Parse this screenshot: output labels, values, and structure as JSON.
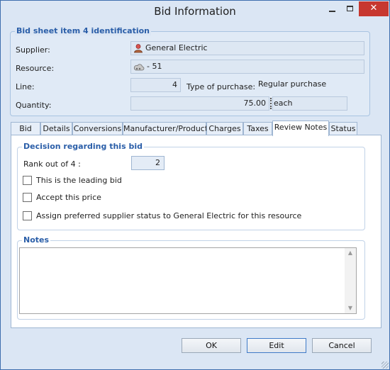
{
  "window": {
    "title": "Bid Information"
  },
  "identification": {
    "title": "Bid sheet item 4 identification",
    "supplier_label": "Supplier:",
    "supplier_value": "General Electric",
    "resource_label": "Resource:",
    "resource_value": "- 51",
    "line_label": "Line:",
    "line_value": "4",
    "type_label": "Type of purchase:",
    "type_value": "Regular purchase",
    "quantity_label": "Quantity:",
    "quantity_value": "75.00",
    "unit_value": "each"
  },
  "tabs": [
    {
      "label": "Bid"
    },
    {
      "label": "Details"
    },
    {
      "label": "Conversions"
    },
    {
      "label": "Manufacturer/Product"
    },
    {
      "label": "Charges"
    },
    {
      "label": "Taxes"
    },
    {
      "label": "Review Notes"
    },
    {
      "label": "Status"
    }
  ],
  "decision": {
    "title": "Decision regarding this bid",
    "rank_label": "Rank out of 4 :",
    "rank_value": "2",
    "leading_bid_label": "This is the leading bid",
    "leading_bid_checked": false,
    "accept_price_label": "Accept this price",
    "accept_price_checked": false,
    "preferred_label": "Assign preferred supplier status to  General Electric for this resource",
    "preferred_checked": false
  },
  "notes": {
    "title": "Notes",
    "value": ""
  },
  "buttons": {
    "ok": "OK",
    "edit": "Edit",
    "cancel": "Cancel"
  },
  "icons": {
    "supplier": "person-icon",
    "resource": "cloud-icon"
  },
  "colors": {
    "accent": "#2a5ea8",
    "close": "#c7372f",
    "window_bg": "#dbe6f4"
  }
}
